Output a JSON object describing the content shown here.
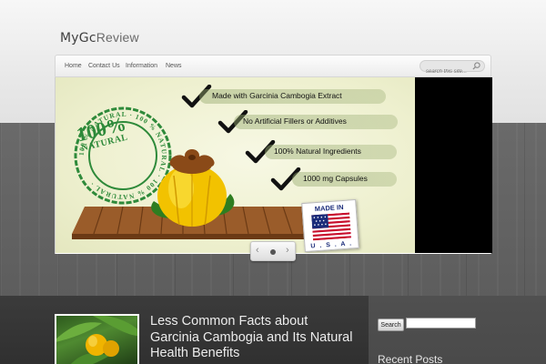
{
  "site": {
    "logo_prefix": "MyGc",
    "logo_suffix": "Review"
  },
  "nav": {
    "items": [
      {
        "label": "Home"
      },
      {
        "label": "Contact Us"
      },
      {
        "label": "Information"
      },
      {
        "label": "News"
      }
    ],
    "search_placeholder": "search this site..."
  },
  "slider": {
    "claims": [
      {
        "text": "Made with Garcinia Cambogia Extract"
      },
      {
        "text": "No Artificial Fillers or Additives"
      },
      {
        "text": "100% Natural Ingredients"
      },
      {
        "text": "1000 mg Capsules"
      }
    ],
    "stamp_big": "100%",
    "stamp_small": "NATURAL",
    "stamp_ring": "100 % NATURAL · 100 % NATURAL · 100 % NATURAL ·",
    "badge_top": "MADE IN",
    "badge_bottom": "U . S . A .",
    "prev_symbol": "‹",
    "next_symbol": "›"
  },
  "post": {
    "title": "Less Common Facts about Garcinia Cambogia and Its Natural Health Benefits"
  },
  "sidebar": {
    "search_button": "Search",
    "heading": "Recent Posts"
  },
  "colors": {
    "stamp_green": "#2e8a3a",
    "slide_background": "#eef0cf",
    "wood": "#5d5d5d"
  }
}
